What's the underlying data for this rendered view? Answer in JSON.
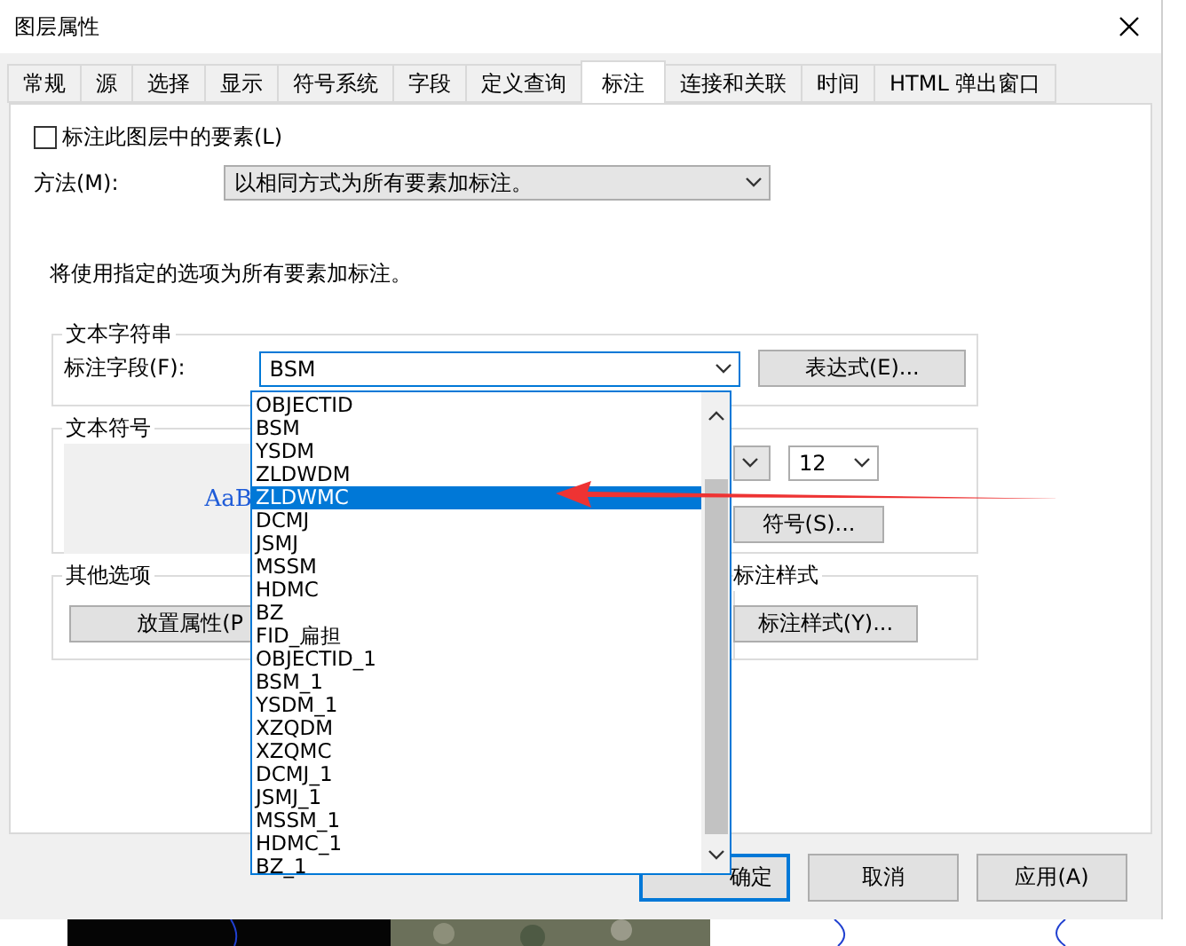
{
  "window": {
    "title": "图层属性"
  },
  "tabs": [
    {
      "label": "常规",
      "selected": false
    },
    {
      "label": "源",
      "selected": false
    },
    {
      "label": "选择",
      "selected": false
    },
    {
      "label": "显示",
      "selected": false
    },
    {
      "label": "符号系统",
      "selected": false
    },
    {
      "label": "字段",
      "selected": false
    },
    {
      "label": "定义查询",
      "selected": false
    },
    {
      "label": "标注",
      "selected": true
    },
    {
      "label": "连接和关联",
      "selected": false
    },
    {
      "label": "时间",
      "selected": false
    },
    {
      "label": "HTML 弹出窗口",
      "selected": false
    }
  ],
  "label_features": {
    "label": "标注此图层中的要素(L)",
    "checked": false
  },
  "method": {
    "label": "方法(M):",
    "value": "以相同方式为所有要素加标注。"
  },
  "description": "将使用指定的选项为所有要素加标注。",
  "text_string": {
    "title": "文本字符串",
    "field_label": "标注字段(F):",
    "field_value": "BSM",
    "expression_button": "表达式(E)...",
    "options": [
      {
        "label": "OBJECTID",
        "selected": false
      },
      {
        "label": "BSM",
        "selected": false
      },
      {
        "label": "YSDM",
        "selected": false
      },
      {
        "label": "ZLDWDM",
        "selected": false
      },
      {
        "label": "ZLDWMC",
        "selected": true
      },
      {
        "label": "DCMJ",
        "selected": false
      },
      {
        "label": "JSMJ",
        "selected": false
      },
      {
        "label": "MSSM",
        "selected": false
      },
      {
        "label": "HDMC",
        "selected": false
      },
      {
        "label": "BZ",
        "selected": false
      },
      {
        "label": "FID_扁担",
        "selected": false
      },
      {
        "label": "OBJECTID_1",
        "selected": false
      },
      {
        "label": "BSM_1",
        "selected": false
      },
      {
        "label": "YSDM_1",
        "selected": false
      },
      {
        "label": "XZQDM",
        "selected": false
      },
      {
        "label": "XZQMC",
        "selected": false
      },
      {
        "label": "DCMJ_1",
        "selected": false
      },
      {
        "label": "JSMJ_1",
        "selected": false
      },
      {
        "label": "MSSM_1",
        "selected": false
      },
      {
        "label": "HDMC_1",
        "selected": false
      },
      {
        "label": "BZ_1",
        "selected": false
      }
    ]
  },
  "text_symbol": {
    "title": "文本符号",
    "preview": "AaB",
    "size": "12",
    "symbol_button": "符号(S)..."
  },
  "other_options": {
    "title": "其他选项",
    "placement_button": "放置属性(P"
  },
  "label_styles": {
    "title": "标注样式",
    "button": "标注样式(Y)..."
  },
  "buttons": [
    {
      "label": "确定",
      "focused": true
    },
    {
      "label": "取消",
      "focused": false
    },
    {
      "label": "应用(A)",
      "focused": false
    }
  ]
}
